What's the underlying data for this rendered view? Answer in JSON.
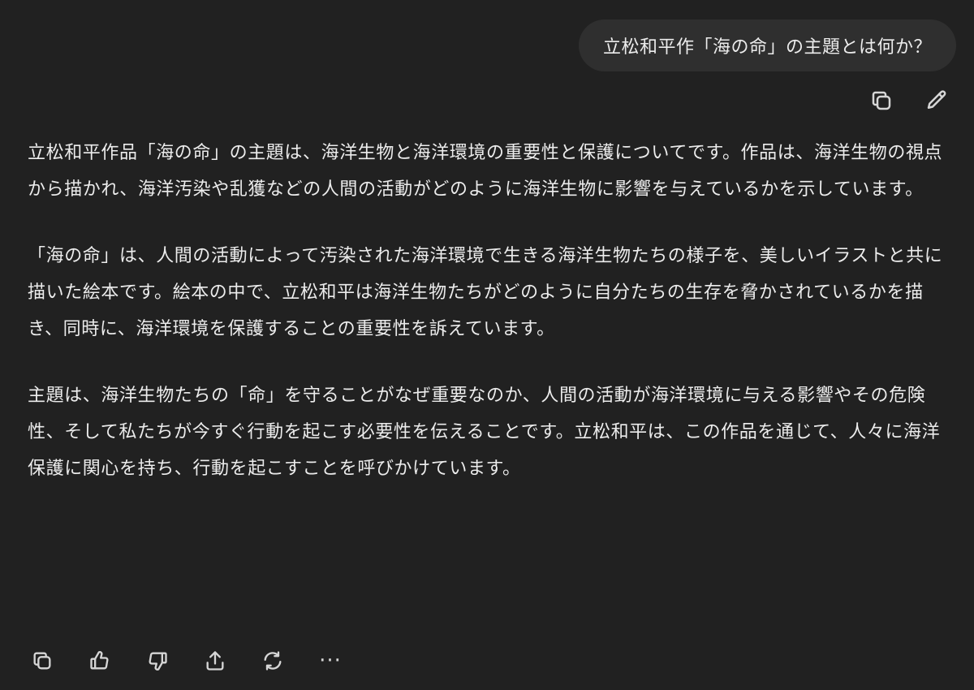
{
  "user_message": {
    "text": "立松和平作「海の命」の主題とは何か？"
  },
  "user_actions": {
    "copy_icon": "copy-icon",
    "edit_icon": "pencil-icon"
  },
  "assistant_message": {
    "paragraphs": [
      "立松和平作品「海の命」の主題は、海洋生物と海洋環境の重要性と保護についてです。作品は、海洋生物の視点から描かれ、海洋汚染や乱獲などの人間の活動がどのように海洋生物に影響を与えているかを示しています。",
      "「海の命」は、人間の活動によって汚染された海洋環境で生きる海洋生物たちの様子を、美しいイラストと共に描いた絵本です。絵本の中で、立松和平は海洋生物たちがどのように自分たちの生存を脅かされているかを描き、同時に、海洋環境を保護することの重要性を訴えています。",
      "主題は、海洋生物たちの「命」を守ることがなぜ重要なのか、人間の活動が海洋環境に与える影響やその危険性、そして私たちが今すぐ行動を起こす必要性を伝えることです。立松和平は、この作品を通じて、人々に海洋保護に関心を持ち、行動を起こすことを呼びかけています。"
    ]
  },
  "assistant_actions": {
    "icons": [
      "copy-icon",
      "thumbs-up-icon",
      "thumbs-down-icon",
      "share-icon",
      "regenerate-icon",
      "more-icon"
    ],
    "more_label": "···"
  },
  "colors": {
    "background": "#212121",
    "bubble": "#2f2f2f",
    "text": "#ececec"
  }
}
